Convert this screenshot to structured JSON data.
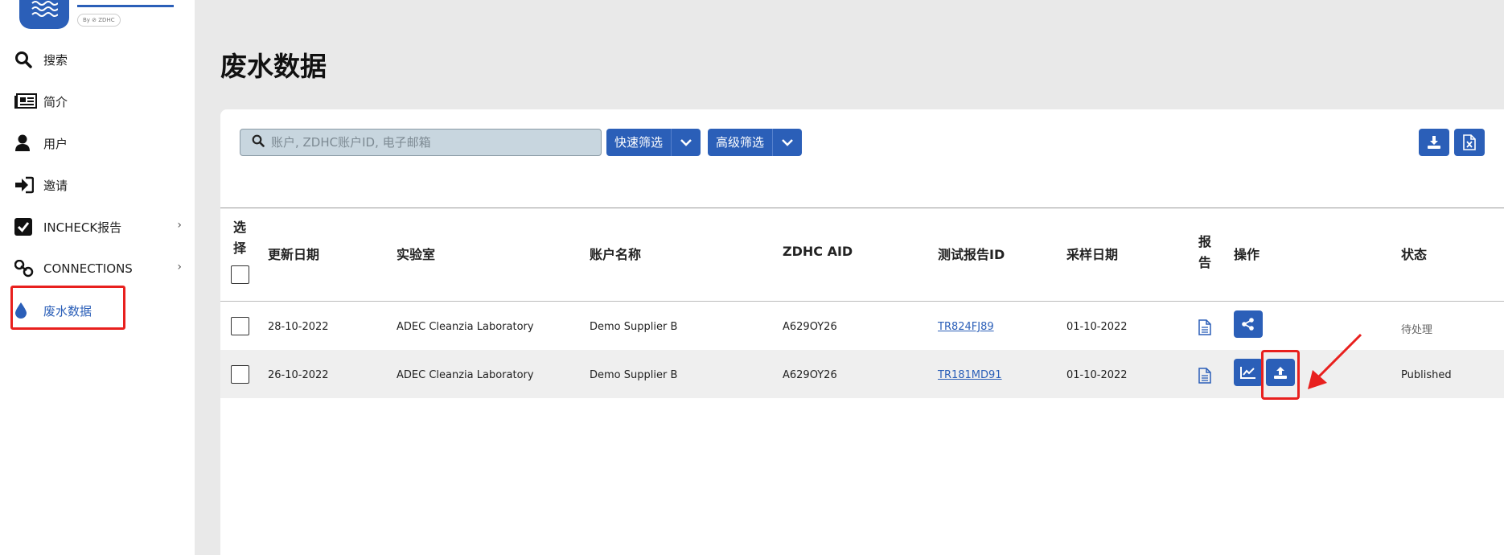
{
  "sidebar": {
    "logo_badge": "By ⊘ ZDHC",
    "items": [
      {
        "label": "搜索",
        "icon": "search-icon",
        "chevron": ""
      },
      {
        "label": "简介",
        "icon": "newspaper-icon",
        "chevron": ""
      },
      {
        "label": "用户",
        "icon": "user-icon",
        "chevron": ""
      },
      {
        "label": "邀请",
        "icon": "sign-in-icon",
        "chevron": ""
      },
      {
        "label": "INCHECK报告",
        "icon": "checkbox-icon",
        "chevron": "›"
      },
      {
        "label": "CONNECTIONS",
        "icon": "link-icon",
        "chevron": "›"
      },
      {
        "label": "废水数据",
        "icon": "droplet-icon",
        "chevron": "",
        "active": true
      }
    ]
  },
  "page": {
    "title": "废水数据"
  },
  "toolbar": {
    "search_placeholder": "账户, ZDHC账户ID, 电子邮箱",
    "quick_filter": "快速筛选",
    "advanced_filter": "高级筛选",
    "download_icon": "download-icon",
    "excel_icon": "excel-icon"
  },
  "table": {
    "headers": {
      "select": "选择",
      "updated": "更新日期",
      "lab": "实验室",
      "account": "账户名称",
      "aid": "ZDHC AID",
      "report_id": "测试报告ID",
      "sample_date": "采样日期",
      "report": "报告",
      "actions": "操作",
      "status": "状态"
    },
    "rows": [
      {
        "updated": "28-10-2022",
        "lab": "ADEC Cleanzia Laboratory",
        "account": "Demo Supplier B",
        "aid": "A629OY26",
        "report_id": "TR824FJ89",
        "sample_date": "01-10-2022",
        "status": "待处理"
      },
      {
        "updated": "26-10-2022",
        "lab": "ADEC Cleanzia Laboratory",
        "account": "Demo Supplier B",
        "aid": "A629OY26",
        "report_id": "TR181MD91",
        "sample_date": "01-10-2022",
        "status": "Published"
      }
    ]
  },
  "colors": {
    "accent": "#2b5fb8",
    "highlight": "#e8201e"
  }
}
